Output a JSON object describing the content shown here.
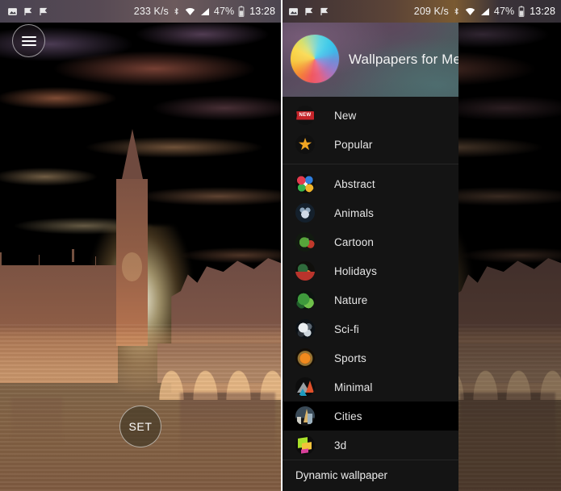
{
  "app": {
    "name": "Wallpapers for Me"
  },
  "left_panel": {
    "status_bar": {
      "network_speed": "233 K/s",
      "battery_percent": "47%",
      "time": "13:28",
      "icons": [
        "image-icon",
        "flag-icon",
        "flag-icon",
        "bluetooth-icon",
        "wifi-icon",
        "signal-icon",
        "battery-icon"
      ]
    },
    "menu_button": "menu-icon",
    "set_button_label": "SET",
    "wallpaper_description": "Big Ben and Westminster at sunset over the Thames"
  },
  "right_panel": {
    "status_bar": {
      "network_speed": "209 K/s",
      "battery_percent": "47%",
      "time": "13:28",
      "icons": [
        "image-icon",
        "flag-icon",
        "flag-icon",
        "bluetooth-icon",
        "wifi-icon",
        "signal-icon",
        "battery-icon"
      ]
    },
    "drawer": {
      "header_title": "Wallpapers for Me",
      "logo": "color-wheel-logo",
      "groups": [
        {
          "items": [
            {
              "label": "New",
              "icon": "new-badge-icon",
              "selected": false
            },
            {
              "label": "Popular",
              "icon": "star-icon",
              "selected": false
            }
          ]
        },
        {
          "items": [
            {
              "label": "Abstract",
              "icon": "abstract-icon",
              "selected": false
            },
            {
              "label": "Animals",
              "icon": "animals-icon",
              "selected": false
            },
            {
              "label": "Cartoon",
              "icon": "cartoon-icon",
              "selected": false
            },
            {
              "label": "Holidays",
              "icon": "holidays-icon",
              "selected": false
            },
            {
              "label": "Nature",
              "icon": "nature-icon",
              "selected": false
            },
            {
              "label": "Sci-fi",
              "icon": "scifi-icon",
              "selected": false
            },
            {
              "label": "Sports",
              "icon": "sports-icon",
              "selected": false
            },
            {
              "label": "Minimal",
              "icon": "minimal-icon",
              "selected": false
            },
            {
              "label": "Cities",
              "icon": "cities-icon",
              "selected": true
            },
            {
              "label": "3d",
              "icon": "cube-icon",
              "selected": false
            }
          ]
        }
      ],
      "footer_label": "Dynamic wallpaper"
    }
  },
  "colors": {
    "drawer_bg": "#141414",
    "selected_row_bg": "#000000",
    "text_primary": "#e6e6e6",
    "status_bar_text": "#f0f0f0",
    "new_badge": "#c5242a",
    "star": "#f0a422"
  }
}
